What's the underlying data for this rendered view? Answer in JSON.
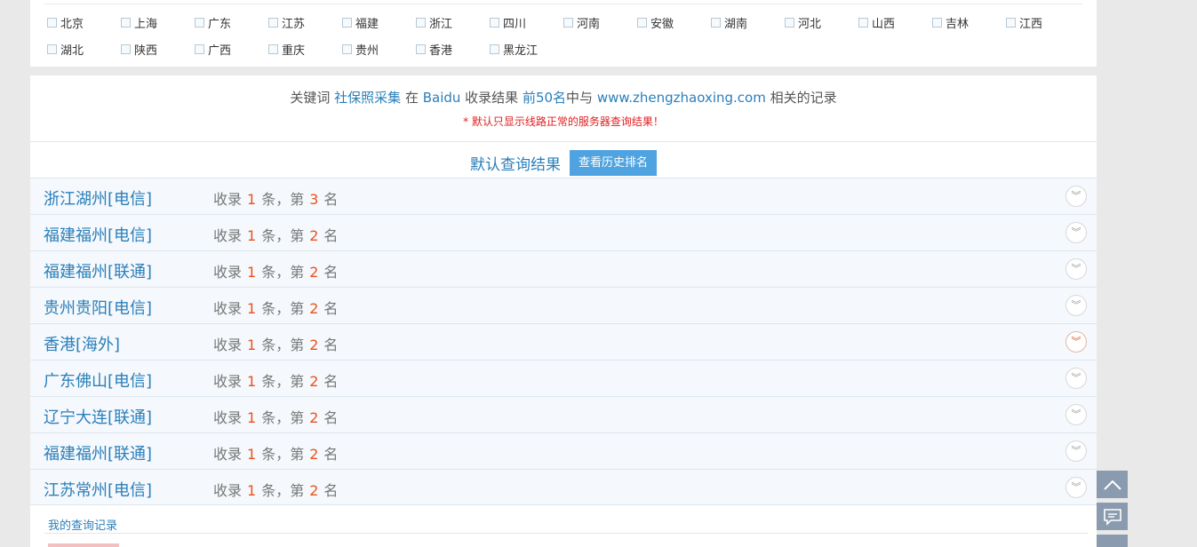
{
  "regions": [
    "北京",
    "上海",
    "广东",
    "江苏",
    "福建",
    "浙江",
    "四川",
    "河南",
    "安徽",
    "湖南",
    "河北",
    "山西",
    "吉林",
    "江西",
    "湖北",
    "陕西",
    "广西",
    "重庆",
    "贵州",
    "香港",
    "黑龙江"
  ],
  "summary": {
    "p1": "关键词 ",
    "keyword": "社保照采集",
    "p2": " 在 ",
    "engine": "Baidu",
    "p3": " 收录结果 ",
    "range": "前50名",
    "p4": "中与 ",
    "domain": "www.zhengzhaoxing.com",
    "p5": " 相关的记录"
  },
  "note": "* 默认只显示线路正常的服务器查询结果！",
  "default_title": "默认查询结果",
  "history_button": "查看历史排名",
  "rows": [
    {
      "loc": "浙江湖州[电信]",
      "count": "1",
      "rank": "3"
    },
    {
      "loc": "福建福州[电信]",
      "count": "1",
      "rank": "2"
    },
    {
      "loc": "福建福州[联通]",
      "count": "1",
      "rank": "2"
    },
    {
      "loc": "贵州贵阳[电信]",
      "count": "1",
      "rank": "2"
    },
    {
      "loc": "香港[海外]",
      "count": "1",
      "rank": "2"
    },
    {
      "loc": "广东佛山[电信]",
      "count": "1",
      "rank": "2"
    },
    {
      "loc": "辽宁大连[联通]",
      "count": "1",
      "rank": "2"
    },
    {
      "loc": "福建福州[联通]",
      "count": "1",
      "rank": "2"
    },
    {
      "loc": "江苏常州[电信]",
      "count": "1",
      "rank": "2"
    }
  ],
  "stat_labels": {
    "a": "收录",
    "b": "条，第",
    "c": "名"
  },
  "my_history": "我的查询记录",
  "icons": {
    "expand": "double-chevron-down-icon",
    "top": "chevron-up-icon",
    "feedback": "chat-bubble-icon"
  },
  "colors": {
    "accent": "#2a7fba",
    "highlight": "#e8531b",
    "button": "#4fa3e0",
    "side": "#8a9bb0"
  }
}
